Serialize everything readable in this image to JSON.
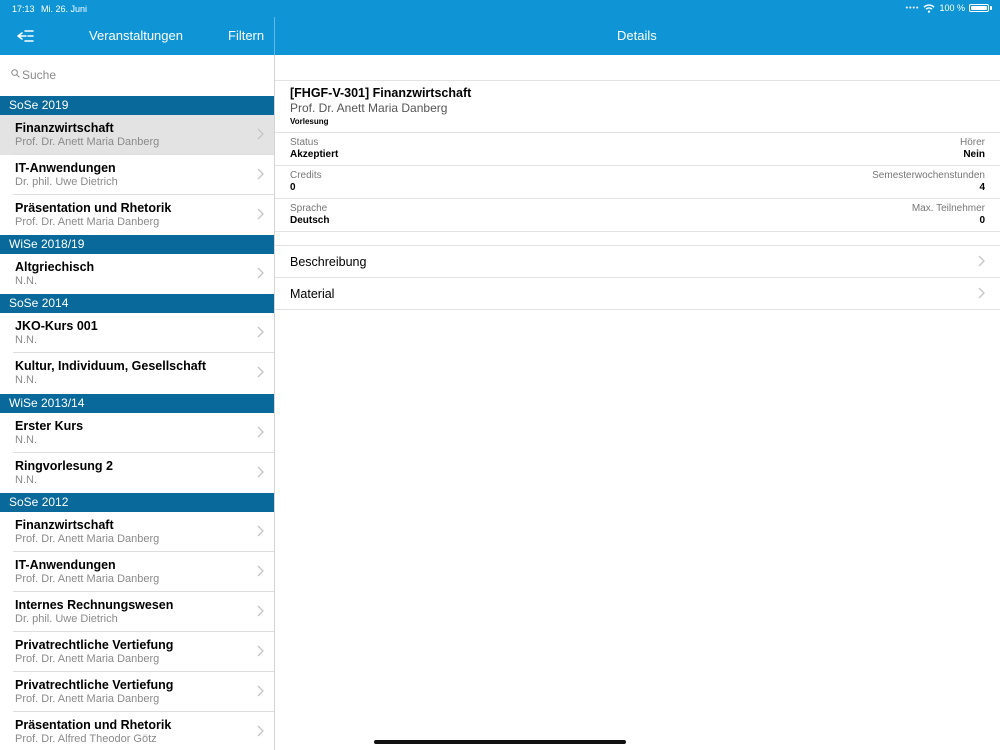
{
  "status_bar": {
    "time": "17:13",
    "date": "Mi. 26. Juni",
    "battery": "100 %"
  },
  "nav": {
    "left_title": "Veranstaltungen",
    "filter_label": "Filtern",
    "right_title": "Details"
  },
  "search": {
    "placeholder": "Suche"
  },
  "sections": [
    {
      "header": "SoSe 2019",
      "items": [
        {
          "title": "Finanzwirtschaft",
          "subtitle": "Prof. Dr. Anett Maria Danberg",
          "selected": true
        },
        {
          "title": "IT-Anwendungen",
          "subtitle": "Dr. phil. Uwe Dietrich"
        },
        {
          "title": "Präsentation und Rhetorik",
          "subtitle": "Prof. Dr. Anett Maria Danberg"
        }
      ]
    },
    {
      "header": "WiSe 2018/19",
      "items": [
        {
          "title": "Altgriechisch",
          "subtitle": "N.N."
        }
      ]
    },
    {
      "header": "SoSe 2014",
      "items": [
        {
          "title": "JKO-Kurs 001",
          "subtitle": "N.N."
        },
        {
          "title": "Kultur, Individuum, Gesellschaft",
          "subtitle": "N.N."
        }
      ]
    },
    {
      "header": "WiSe 2013/14",
      "items": [
        {
          "title": "Erster Kurs",
          "subtitle": "N.N."
        },
        {
          "title": "Ringvorlesung 2",
          "subtitle": "N.N."
        }
      ]
    },
    {
      "header": "SoSe 2012",
      "items": [
        {
          "title": "Finanzwirtschaft",
          "subtitle": "Prof. Dr. Anett Maria Danberg"
        },
        {
          "title": "IT-Anwendungen",
          "subtitle": "Prof. Dr. Anett Maria Danberg"
        },
        {
          "title": "Internes Rechnungswesen",
          "subtitle": "Dr. phil. Uwe Dietrich"
        },
        {
          "title": "Privatrechtliche Vertiefung",
          "subtitle": "Prof. Dr. Anett Maria Danberg"
        },
        {
          "title": "Privatrechtliche Vertiefung",
          "subtitle": "Prof. Dr. Anett Maria Danberg"
        },
        {
          "title": "Präsentation und Rhetorik",
          "subtitle": "Prof. Dr. Alfred Theodor Götz"
        }
      ]
    }
  ],
  "detail": {
    "title": "[FHGF-V-301] Finanzwirtschaft",
    "lecturer": "Prof. Dr. Anett Maria Danberg",
    "type": "Vorlesung",
    "fields": [
      {
        "left_label": "Status",
        "left_value": "Akzeptiert",
        "right_label": "Hörer",
        "right_value": "Nein"
      },
      {
        "left_label": "Credits",
        "left_value": "0",
        "right_label": "Semesterwochenstunden",
        "right_value": "4"
      },
      {
        "left_label": "Sprache",
        "left_value": "Deutsch",
        "right_label": "Max. Teilnehmer",
        "right_value": "0"
      }
    ],
    "links": [
      "Beschreibung",
      "Material"
    ]
  },
  "colors": {
    "accent": "#0f95d6",
    "section_header": "#09699a",
    "selected_row": "#e3e3e3"
  }
}
